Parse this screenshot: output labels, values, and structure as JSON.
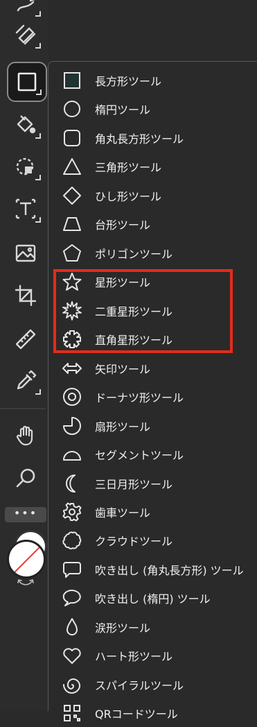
{
  "toolbar": {
    "tools": [
      {
        "icon": "curve-pen-icon"
      },
      {
        "icon": "ruler-pen-icon"
      },
      {
        "icon": "rectangle-icon",
        "selected": true
      },
      {
        "icon": "fill-bucket-icon"
      },
      {
        "icon": "lasso-selection-icon"
      },
      {
        "icon": "text-icon"
      },
      {
        "icon": "image-icon"
      },
      {
        "icon": "crop-icon"
      },
      {
        "icon": "measure-icon"
      },
      {
        "icon": "eyedropper-icon"
      },
      {
        "icon": "hand-icon"
      },
      {
        "icon": "zoom-icon"
      }
    ],
    "more_label": "•••",
    "stroke_color": "#ffffff",
    "fill_color": "#ffffff",
    "none_indicator_color": "#e23a2e"
  },
  "menu": {
    "items": [
      {
        "label": "長方形ツール",
        "icon": "rectangle-icon"
      },
      {
        "label": "楕円ツール",
        "icon": "ellipse-icon"
      },
      {
        "label": "角丸長方形ツール",
        "icon": "rounded-rectangle-icon"
      },
      {
        "label": "三角形ツール",
        "icon": "triangle-icon"
      },
      {
        "label": "ひし形ツール",
        "icon": "diamond-icon"
      },
      {
        "label": "台形ツール",
        "icon": "trapezoid-icon"
      },
      {
        "label": "ポリゴンツール",
        "icon": "pentagon-icon"
      },
      {
        "label": "星形ツール",
        "icon": "star-icon"
      },
      {
        "label": "二重星形ツール",
        "icon": "double-star-icon"
      },
      {
        "label": "直角星形ツール",
        "icon": "right-angle-star-icon"
      },
      {
        "label": "矢印ツール",
        "icon": "double-arrow-icon"
      },
      {
        "label": "ドーナツ形ツール",
        "icon": "donut-icon"
      },
      {
        "label": "扇形ツール",
        "icon": "sector-icon"
      },
      {
        "label": "セグメントツール",
        "icon": "segment-icon"
      },
      {
        "label": "三日月形ツール",
        "icon": "crescent-icon"
      },
      {
        "label": "歯車ツール",
        "icon": "gear-icon"
      },
      {
        "label": "クラウドツール",
        "icon": "cloud-icon"
      },
      {
        "label": "吹き出し (角丸長方形) ツール",
        "icon": "speech-bubble-rect-icon"
      },
      {
        "label": "吹き出し (楕円) ツール",
        "icon": "speech-bubble-ellipse-icon"
      },
      {
        "label": "涙形ツール",
        "icon": "teardrop-icon"
      },
      {
        "label": "ハート形ツール",
        "icon": "heart-icon"
      },
      {
        "label": "スパイラルツール",
        "icon": "spiral-icon"
      },
      {
        "label": "QRコードツール",
        "icon": "qr-code-icon"
      }
    ],
    "highlight_color": "#e52b1b"
  }
}
